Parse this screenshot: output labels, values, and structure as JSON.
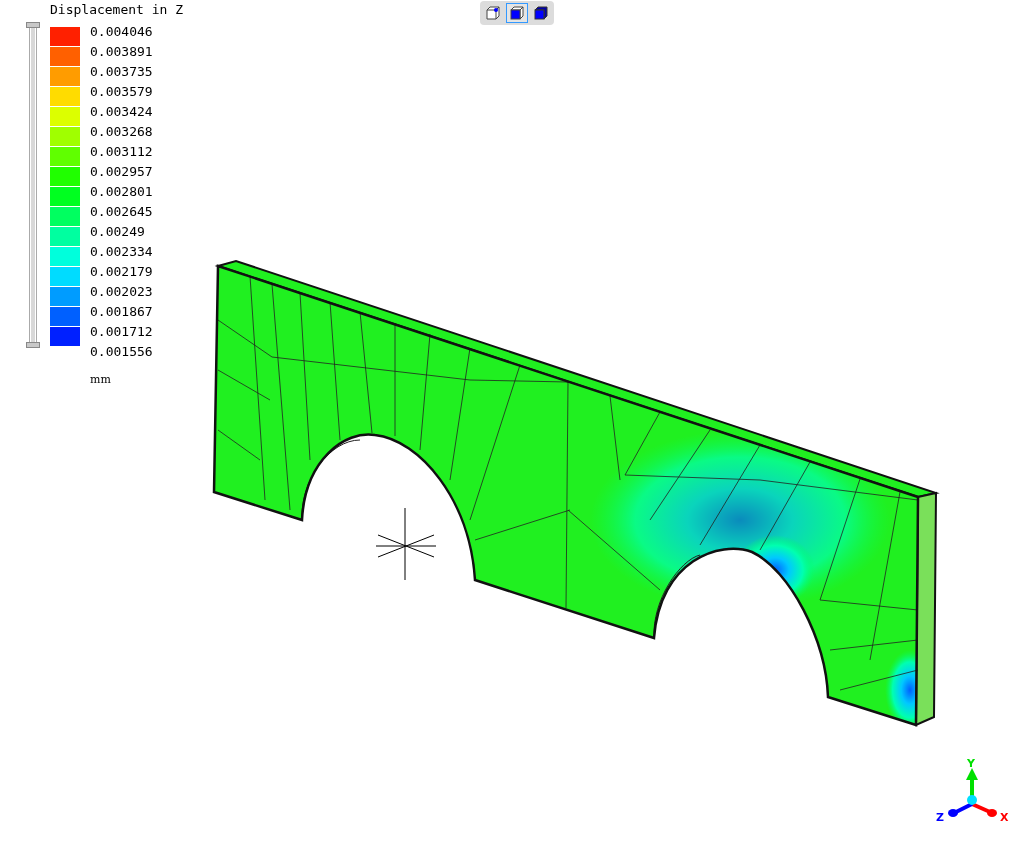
{
  "legend": {
    "title": "Displacement in Z",
    "bands": [
      {
        "color": "#ff2000"
      },
      {
        "color": "#ff6000"
      },
      {
        "color": "#ff9c00"
      },
      {
        "color": "#ffdc00"
      },
      {
        "color": "#dcff00"
      },
      {
        "color": "#a0ff00"
      },
      {
        "color": "#60ff00"
      },
      {
        "color": "#20ff00"
      },
      {
        "color": "#00ff20"
      },
      {
        "color": "#00ff60"
      },
      {
        "color": "#00ffa0"
      },
      {
        "color": "#00ffdc"
      },
      {
        "color": "#00dcff"
      },
      {
        "color": "#009cff"
      },
      {
        "color": "#0060ff"
      },
      {
        "color": "#0020ff"
      }
    ],
    "values": [
      "0.004046",
      "0.003891",
      "0.003735",
      "0.003579",
      "0.003424",
      "0.003268",
      "0.003112",
      "0.002957",
      "0.002801",
      "0.002645",
      "0.00249",
      "0.002334",
      "0.002179",
      "0.002023",
      "0.001867",
      "0.001712",
      "0.001556"
    ],
    "unit": "mm",
    "slider": {
      "level": 1
    }
  },
  "view_buttons": [
    {
      "kind": "wireframe",
      "selected": false
    },
    {
      "kind": "solid",
      "selected": true
    },
    {
      "kind": "shaded",
      "selected": false
    }
  ],
  "axes": {
    "x": "X",
    "y": "Y",
    "z": "Z"
  }
}
